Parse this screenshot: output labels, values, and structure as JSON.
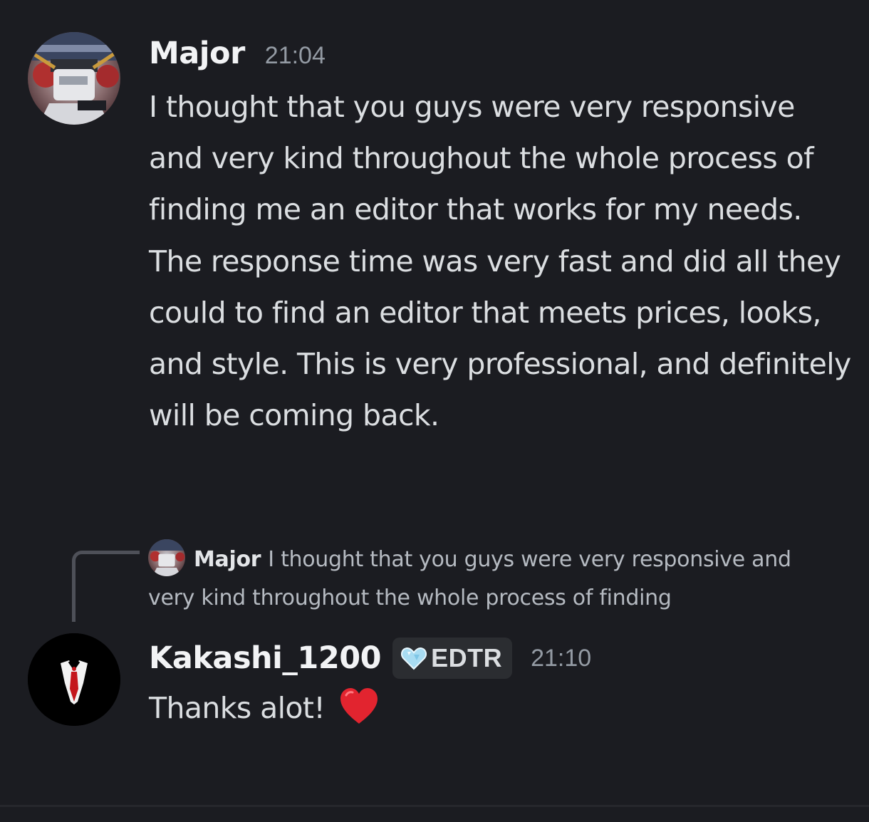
{
  "messages": [
    {
      "author": "Major",
      "timestamp": "21:04",
      "avatar_icon": "major-avatar-icon",
      "text": "I thought that you guys were very responsive and very kind throughout the whole process of finding me an editor that works for my needs. The response time was very fast and did all they could to find an editor that meets prices, looks, and style. This is very professional, and definitely will be coming back."
    },
    {
      "author": "Kakashi_1200",
      "timestamp": "21:10",
      "avatar_icon": "kakashi-avatar-icon",
      "role_badge": {
        "icon": "diamond-heart-icon",
        "label": "EDTR",
        "color": "#a8dcf2"
      },
      "text": "Thanks alot!",
      "emoji": "heart-icon",
      "reply_to": {
        "author": "Major",
        "preview": "I thought that you guys were very responsive and very kind throughout the whole process of finding"
      }
    }
  ],
  "colors": {
    "background": "#1b1c21",
    "username": "#f2f3f5",
    "timestamp": "#949ba4",
    "message_text": "#dbdee1",
    "heart": "#e2242f"
  }
}
